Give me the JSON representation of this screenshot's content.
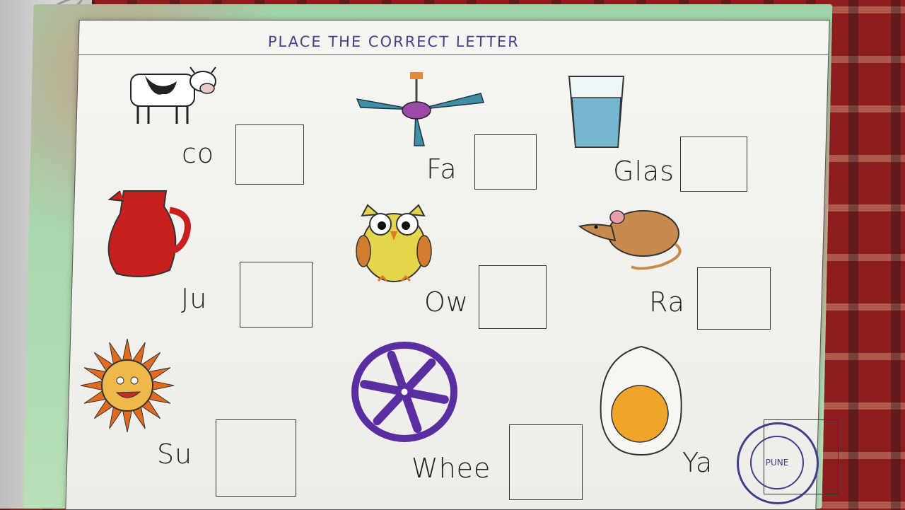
{
  "worksheet": {
    "title": "PLACE THE CORRECT LETTER",
    "items": [
      {
        "word": "co",
        "picture": "cow-drawing"
      },
      {
        "word": "Fa",
        "picture": "ceiling-fan-drawing"
      },
      {
        "word": "Glas",
        "picture": "glass-of-water-drawing"
      },
      {
        "word": "Ju",
        "picture": "red-jug-drawing"
      },
      {
        "word": "Ow",
        "picture": "owl-drawing"
      },
      {
        "word": "Ra",
        "picture": "rat-drawing"
      },
      {
        "word": "Su",
        "picture": "sun-drawing"
      },
      {
        "word": "Whee",
        "picture": "wheel-drawing"
      },
      {
        "word": "Ya",
        "picture": "egg-yolk-drawing"
      }
    ],
    "stamp": {
      "city": "PUNE"
    }
  },
  "colors": {
    "title_ink": "#4a3f8a",
    "board_green": "#9fd3a6",
    "board_red_chalk": "#dc7878",
    "stamp_ink": "#3f3f8c",
    "background_fabric": "#8e1d1f"
  }
}
